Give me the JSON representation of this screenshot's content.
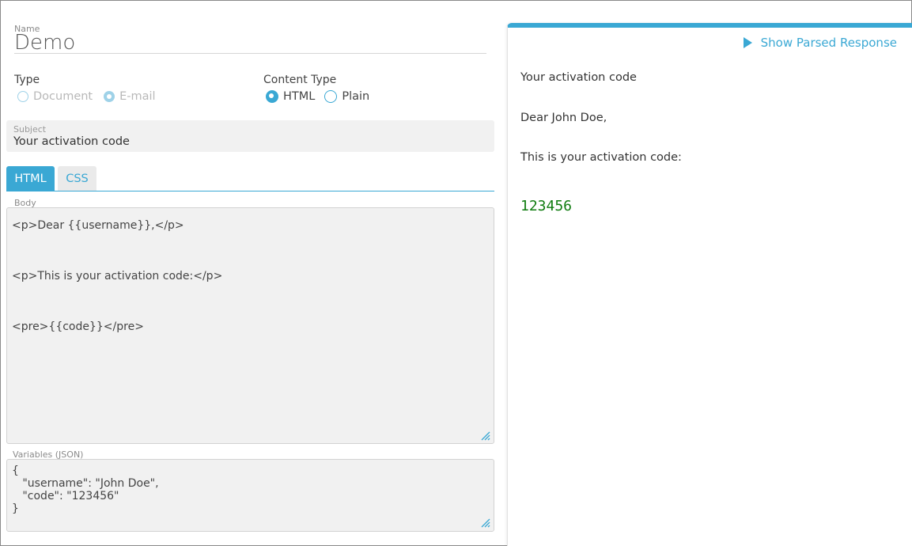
{
  "form": {
    "name_label": "Name",
    "name_value": "Demo",
    "type_label": "Type",
    "type_options": [
      "Document",
      "E-mail"
    ],
    "content_type_label": "Content Type",
    "content_type_options": [
      "HTML",
      "Plain"
    ],
    "subject_label": "Subject",
    "subject_value": "Your activation code",
    "tabs": [
      "HTML",
      "CSS"
    ],
    "body_label": "Body",
    "body_value": "<p>Dear {{username}},</p>\n\n<p>This is your activation code:</p>\n\n<pre>{{code}}</pre>",
    "variables_label": "Variables (JSON)",
    "variables_value": "{\n   \"username\": \"John Doe\",\n   \"code\": \"123456\"\n}"
  },
  "preview": {
    "show_parsed_label": "Show Parsed Response",
    "subject": "Your activation code",
    "greeting": "Dear John Doe,",
    "line": "This is your activation code:",
    "code": "123456"
  },
  "colors": {
    "accent": "#3aa8d4",
    "code_green": "#107c10"
  }
}
